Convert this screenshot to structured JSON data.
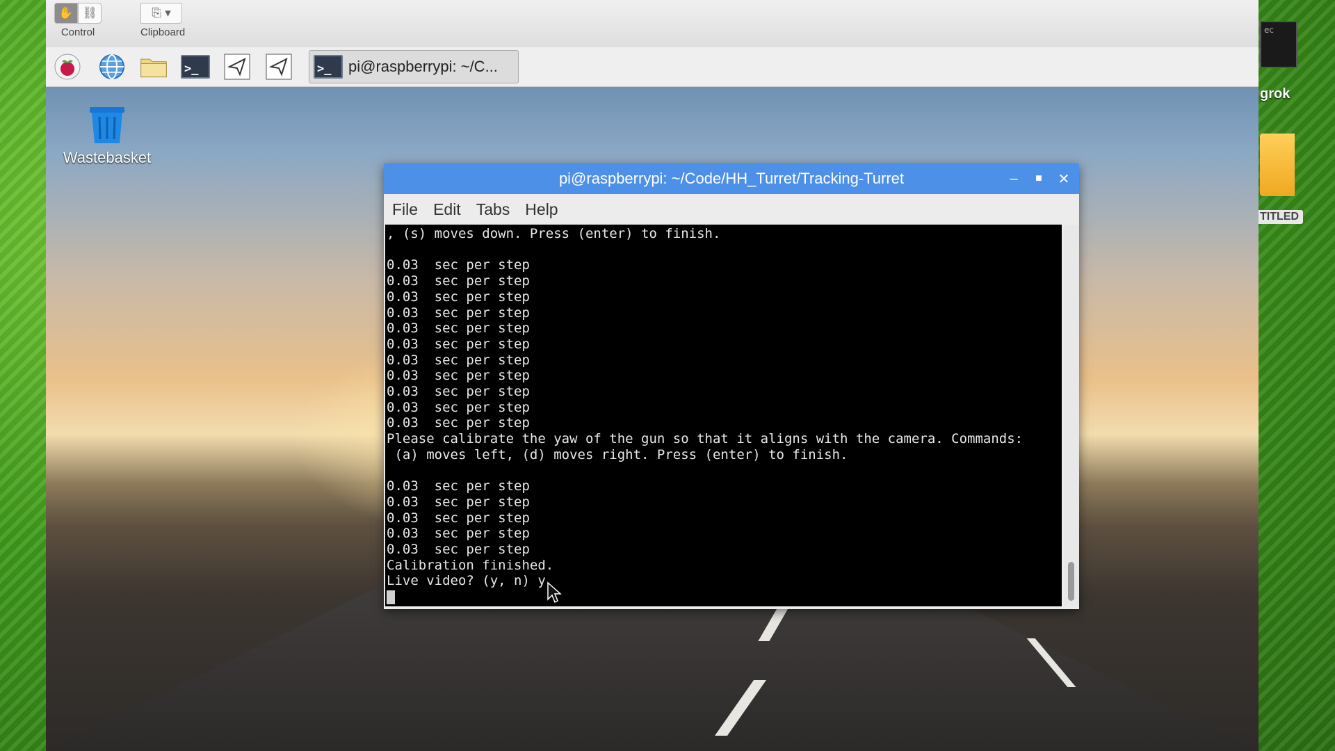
{
  "vnc_toolbar": {
    "control_label": "Control",
    "clipboard_label": "Clipboard"
  },
  "desktop": {
    "wastebasket_label": "Wastebasket",
    "taskbar_window_label": "pi@raspberrypi: ~/C..."
  },
  "terminal": {
    "title": "pi@raspberrypi: ~/Code/HH_Turret/Tracking-Turret",
    "menu": [
      "File",
      "Edit",
      "Tabs",
      "Help"
    ],
    "lines": [
      ", (s) moves down. Press (enter) to finish.",
      "",
      "0.03  sec per step",
      "0.03  sec per step",
      "0.03  sec per step",
      "0.03  sec per step",
      "0.03  sec per step",
      "0.03  sec per step",
      "0.03  sec per step",
      "0.03  sec per step",
      "0.03  sec per step",
      "0.03  sec per step",
      "0.03  sec per step",
      "Please calibrate the yaw of the gun so that it aligns with the camera. Commands:",
      " (a) moves left, (d) moves right. Press (enter) to finish.",
      "",
      "0.03  sec per step",
      "0.03  sec per step",
      "0.03  sec per step",
      "0.03  sec per step",
      "0.03  sec per step",
      "Calibration finished.",
      "Live video? (y, n) y"
    ]
  },
  "host": {
    "right_window_text": "ec",
    "grok_label": "grok",
    "drive_label": "TITLED"
  },
  "colors": {
    "title_bar": "#4d90e8",
    "terminal_bg": "#000000",
    "terminal_fg": "#e8e8e8"
  }
}
